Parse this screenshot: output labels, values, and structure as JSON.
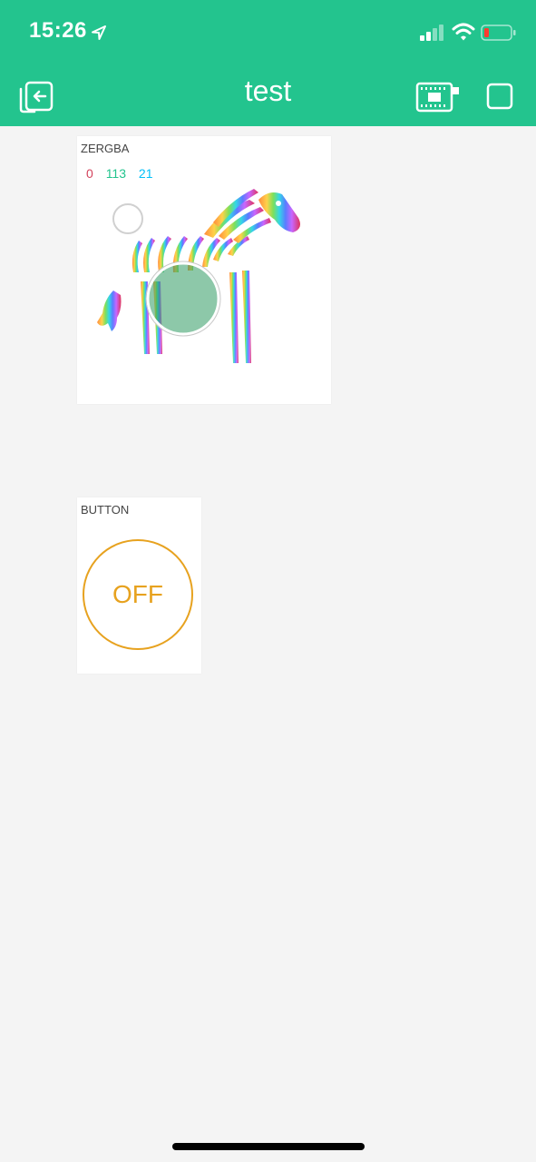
{
  "status_bar": {
    "time": "15:26",
    "icons": [
      "location-arrow-icon",
      "cellular-signal-icon",
      "wifi-icon",
      "battery-low-icon"
    ]
  },
  "nav": {
    "title": "test",
    "left_icon": "exit-icon",
    "right_icons": [
      "device-board-icon",
      "stop-square-icon"
    ],
    "bar_color": "#23c48e"
  },
  "zergba": {
    "label": "ZERGBA",
    "r": "0",
    "g": "113",
    "b": "21",
    "colors": {
      "r": "#d3435c",
      "g": "#23c48e",
      "b": "#04c0f8"
    }
  },
  "button": {
    "label": "BUTTON",
    "state_text": "OFF",
    "color": "#e7a21f"
  }
}
